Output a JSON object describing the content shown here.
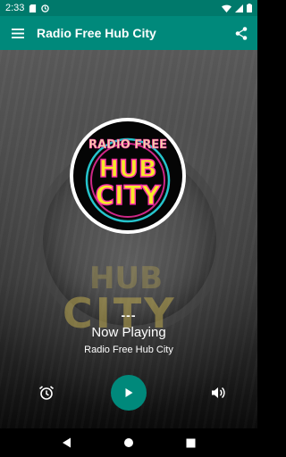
{
  "status_bar": {
    "time": "2:33",
    "icons": [
      "sd-card-icon",
      "sync-icon",
      "wifi-icon",
      "signal-icon",
      "battery-icon"
    ]
  },
  "app_bar": {
    "title": "Radio Free Hub City",
    "menu_icon": "menu-icon",
    "share_icon": "share-icon"
  },
  "logo": {
    "top_text": "RADIO FREE",
    "line1": "HUB",
    "line2": "CITY",
    "bg_text_1": "HUB",
    "bg_text_2": "CITY"
  },
  "now_playing": {
    "track": "---",
    "label": "Now Playing",
    "station": "Radio Free Hub City"
  },
  "controls": {
    "alarm_icon": "alarm-icon",
    "play_icon": "play-icon",
    "volume_icon": "volume-icon"
  },
  "colors": {
    "status_bar": "#00796b",
    "app_bar": "#00897b",
    "accent": "#00897b",
    "logo_pink": "#ff2fa8",
    "logo_yellow": "#f5e92a",
    "logo_cyan": "#2ce6f0"
  },
  "nav_bar": {
    "buttons": [
      "back-icon",
      "home-icon",
      "recents-icon"
    ]
  }
}
